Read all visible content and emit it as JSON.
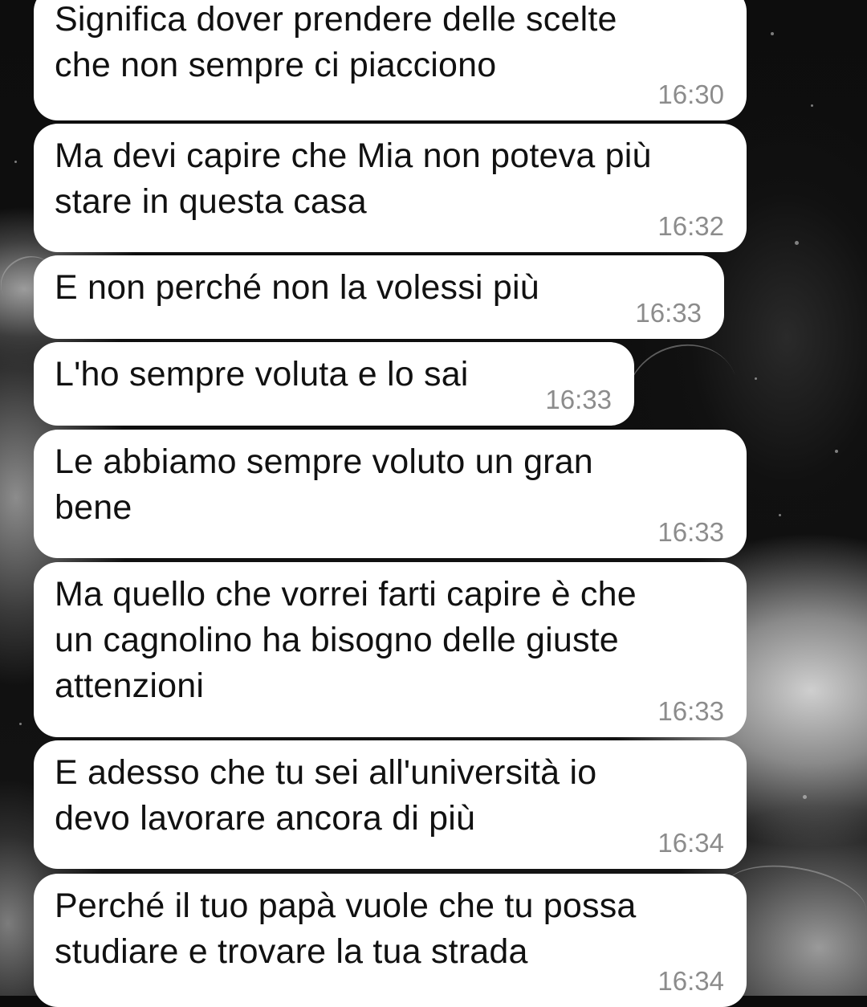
{
  "messages": [
    {
      "text": "Significa dover prendere delle scelte\nche non sempre ci piacciono",
      "time": "16:30"
    },
    {
      "text": "Ma devi capire che Mia non poteva più\nstare in questa casa",
      "time": "16:32"
    },
    {
      "text": "E non perché non la volessi più",
      "time": "16:33"
    },
    {
      "text": "L'ho sempre voluta e lo sai",
      "time": "16:33"
    },
    {
      "text": "Le abbiamo sempre voluto un gran\nbene",
      "time": "16:33"
    },
    {
      "text": "Ma quello che vorrei farti capire è che\nun cagnolino ha bisogno delle giuste\nattenzioni",
      "time": "16:33"
    },
    {
      "text": "E adesso che tu sei all'università io\ndevo lavorare ancora di più",
      "time": "16:34"
    },
    {
      "text": "Perché il tuo papà vuole che tu possa\nstudiare e trovare la tua strada",
      "time": "16:34"
    }
  ],
  "colors": {
    "bubble": "#ffffff",
    "text": "#111111",
    "timestamp": "#8c8c8c",
    "background": "#0b0b0b"
  }
}
